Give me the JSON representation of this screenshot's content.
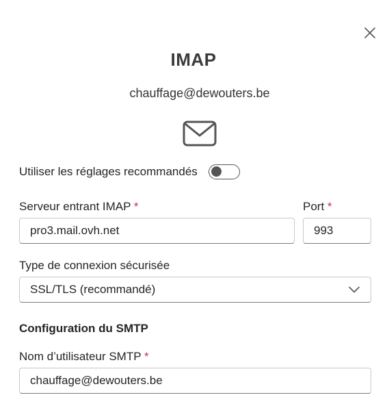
{
  "dialog": {
    "title": "IMAP",
    "email": "chauffage@dewouters.be",
    "icons": {
      "close": "close-icon",
      "mail": "mail-envelope-icon",
      "chevron": "chevron-down-icon"
    },
    "colors": {
      "required": "#c4314b",
      "toggle_off": "#555555"
    }
  },
  "recommended_settings": {
    "label": "Utiliser les réglages recommandés",
    "enabled": false
  },
  "incoming_server": {
    "label": "Serveur entrant IMAP",
    "required_mark": "*",
    "value": "pro3.mail.ovh.net"
  },
  "port": {
    "label": "Port",
    "required_mark": "*",
    "value": "993"
  },
  "security": {
    "label": "Type de connexion sécurisée",
    "selected": "SSL/TLS (recommandé)"
  },
  "smtp": {
    "section_title": "Configuration du SMTP",
    "username_label": "Nom d’utilisateur SMTP",
    "required_mark": "*",
    "username_value": "chauffage@dewouters.be"
  }
}
